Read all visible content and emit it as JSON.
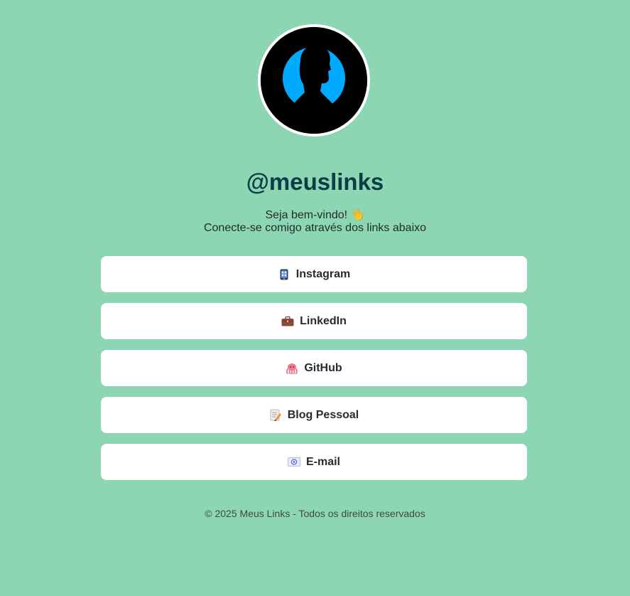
{
  "profile": {
    "handle": "@meuslinks",
    "greeting_line1": "Seja bem-vindo! 👋",
    "greeting_line2": "Conecte-se comigo através dos links abaixo",
    "avatar_icon": "person-silhouette-icon"
  },
  "links": [
    {
      "label": "Instagram",
      "icon": "phone-icon"
    },
    {
      "label": "LinkedIn",
      "icon": "briefcase-icon"
    },
    {
      "label": "GitHub",
      "icon": "octopus-icon"
    },
    {
      "label": "Blog Pessoal",
      "icon": "memo-icon"
    },
    {
      "label": "E-mail",
      "icon": "email-icon"
    }
  ],
  "footer": {
    "text": "© 2025 Meus Links - Todos os direitos reservados"
  },
  "colors": {
    "background": "#8cd6b4",
    "button_bg": "#ffffff",
    "handle_text": "#0b3d45",
    "avatar_accent": "#00aaff"
  }
}
